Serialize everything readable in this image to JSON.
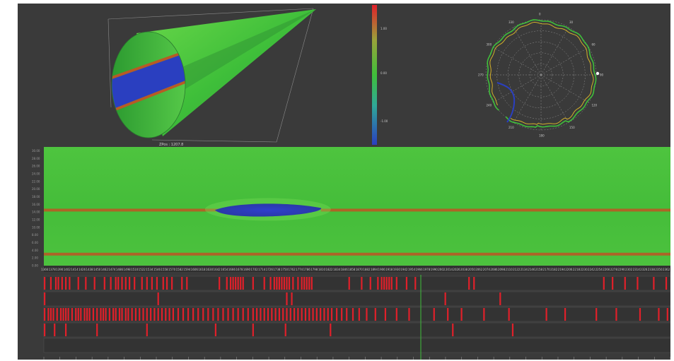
{
  "cone": {
    "caption": "ZPos : 1207.8"
  },
  "colors": {
    "background": "#3a3a3a",
    "green": "#3fbf3a",
    "red": "#e0202a",
    "blue": "#2a3fc0",
    "orange_band": "#b85a25"
  },
  "chart_data": [
    {
      "type": "heatmap",
      "title": "",
      "value_ticks": [
        "1.00",
        "0.00",
        "-1.00"
      ],
      "note_cone": "tubular cone rendering with a blue defect band",
      "defect": {
        "x_start": 1640,
        "x_end": 1810,
        "y_center": 14.5
      }
    },
    {
      "type": "line",
      "subtype": "polar",
      "angle_labels": [
        "0",
        "30",
        "60",
        "90",
        "120",
        "150",
        "180",
        "210",
        "240",
        "270",
        "300",
        "330"
      ],
      "rings": 5,
      "series": [
        {
          "color": "#3fbf3a",
          "role": "outer_profile"
        },
        {
          "color": "#d4b02a",
          "role": "inner_profile"
        },
        {
          "color": "#2a3fc0",
          "role": "defect_segment"
        }
      ]
    },
    {
      "type": "heatmap",
      "y_ticks": [
        "30.00",
        "28.00",
        "26.00",
        "24.00",
        "22.00",
        "20.00",
        "18.00",
        "16.00",
        "14.00",
        "12.00",
        "10.00",
        "8.00",
        "6.00",
        "4.00",
        "2.00",
        "0.00"
      ],
      "x_ticks": [
        "1366",
        "1378",
        "1390",
        "1402",
        "1414",
        "1426",
        "1438",
        "1450",
        "1462",
        "1474",
        "1486",
        "1498",
        "1510",
        "1522",
        "1534",
        "1546",
        "1558",
        "1570",
        "1582",
        "1594",
        "1606",
        "1618",
        "1630",
        "1642",
        "1654",
        "1666",
        "1678",
        "1690",
        "1702",
        "1714",
        "1726",
        "1738",
        "1750",
        "1762",
        "1774",
        "1786",
        "1798",
        "1810",
        "1822",
        "1834",
        "1846",
        "1858",
        "1870",
        "1882",
        "1894",
        "1906",
        "1918",
        "1930",
        "1942",
        "1954",
        "1966",
        "1978",
        "1990",
        "2002",
        "2014",
        "2026",
        "2038",
        "2050",
        "2062",
        "2074",
        "2086",
        "2098",
        "2110",
        "2122",
        "2134",
        "2146",
        "2158",
        "2170",
        "2182",
        "2194",
        "2206",
        "2218",
        "2230",
        "2242",
        "2254",
        "2266",
        "2278",
        "2290",
        "2302",
        "2314",
        "2326",
        "2338",
        "2350",
        "2362"
      ],
      "x_range": [
        1366,
        2370
      ],
      "y_range": [
        0,
        31
      ],
      "bands": [
        {
          "y": 14.5,
          "color": "#b85a25",
          "x_ranges": [
            [
              1366,
              1645
            ],
            [
              1810,
              2370
            ]
          ]
        },
        {
          "y": 3.0,
          "color": "#b85a25",
          "x_ranges": [
            [
              1366,
              2370
            ]
          ]
        }
      ],
      "defect": {
        "x_start": 1640,
        "x_end": 1810,
        "y_center": 14.5,
        "color": "#2a3fc0"
      }
    },
    {
      "type": "bar",
      "subtype": "event_tracks",
      "x_range": [
        1366,
        2370
      ],
      "cursor_x": 1970,
      "tracks": [
        {
          "label": "",
          "events": [
            1366,
            1376,
            1384,
            1388,
            1394,
            1400,
            1406,
            1420,
            1432,
            1446,
            1462,
            1472,
            1480,
            1484,
            1490,
            1496,
            1502,
            1510,
            1522,
            1530,
            1538,
            1546,
            1556,
            1562,
            1570,
            1586,
            1594,
            1646,
            1658,
            1664,
            1668,
            1672,
            1676,
            1680,
            1684,
            1700,
            1718,
            1728,
            1734,
            1738,
            1742,
            1746,
            1750,
            1754,
            1758,
            1764,
            1772,
            1778,
            1782,
            1786,
            1790,
            1794,
            1854,
            1874,
            1888,
            1900,
            1906,
            1910,
            1914,
            1918,
            1922,
            1930,
            1946,
            1960,
            2046,
            2054,
            2262,
            2276,
            2296,
            2316,
            2342,
            2362
          ]
        },
        {
          "label": "",
          "events": [
            1366,
            1548,
            1754,
            1762,
            2008,
            2096
          ]
        },
        {
          "label": "",
          "events": [
            1366,
            1372,
            1376,
            1380,
            1386,
            1392,
            1396,
            1400,
            1404,
            1410,
            1416,
            1420,
            1424,
            1430,
            1434,
            1438,
            1444,
            1450,
            1456,
            1460,
            1464,
            1470,
            1476,
            1480,
            1486,
            1490,
            1496,
            1500,
            1506,
            1512,
            1518,
            1524,
            1530,
            1536,
            1542,
            1548,
            1554,
            1560,
            1566,
            1572,
            1580,
            1588,
            1596,
            1604,
            1612,
            1620,
            1628,
            1636,
            1644,
            1652,
            1660,
            1668,
            1676,
            1684,
            1692,
            1700,
            1706,
            1712,
            1718,
            1724,
            1730,
            1736,
            1742,
            1748,
            1754,
            1760,
            1766,
            1772,
            1778,
            1784,
            1790,
            1796,
            1802,
            1808,
            1814,
            1820,
            1826,
            1834,
            1842,
            1850,
            1860,
            1870,
            1882,
            1896,
            1912,
            1930,
            1950,
            1990,
            2012,
            2034,
            2070,
            2110,
            2170,
            2200,
            2250,
            2282,
            2320,
            2350,
            2364
          ]
        },
        {
          "label": "",
          "events": [
            1366,
            1382,
            1400,
            1450,
            1530,
            1640,
            1700,
            1752,
            1824,
            2020,
            2116
          ]
        },
        {
          "label": "",
          "events": []
        }
      ]
    }
  ]
}
